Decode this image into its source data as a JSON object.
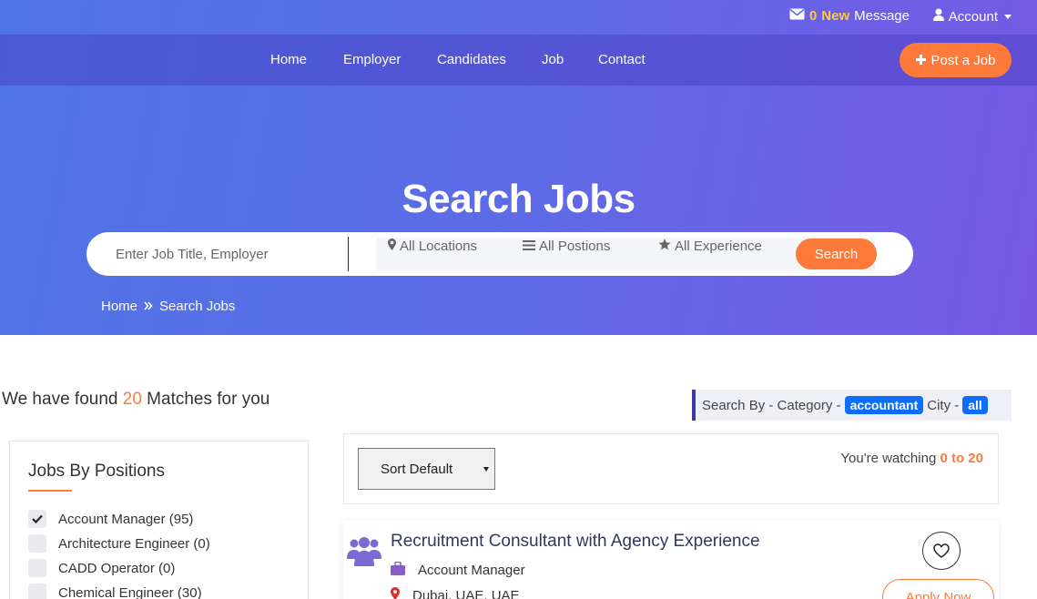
{
  "topbar": {
    "message_count": "0",
    "message_new": "New",
    "message_label": "Message",
    "account_label": "Account"
  },
  "nav": {
    "items": [
      "Home",
      "Employer",
      "Candidates",
      "Job",
      "Contact"
    ],
    "post_job_label": "Post a Job"
  },
  "hero": {
    "title": "Search Jobs",
    "search_placeholder": "Enter Job Title, Employer",
    "location_filter": "All Locations",
    "position_filter": "All Postions",
    "experience_filter": "All Experience",
    "search_button": "Search"
  },
  "breadcrumb": {
    "home": "Home",
    "current": "Search Jobs"
  },
  "results": {
    "found_prefix": "We have found",
    "found_count": "20",
    "found_suffix": "Matches for you",
    "search_by_prefix": "Search By - Category -",
    "category_value": "accountant",
    "city_label": "City -",
    "city_value": "all",
    "sort_selected": "Sort Default",
    "watching_prefix": "You're watching",
    "watching_range": "0 to 20"
  },
  "sidebar": {
    "title": "Jobs By Positions",
    "positions": [
      {
        "label": "Account Manager (95)",
        "checked": true
      },
      {
        "label": "Architecture Engineer (0)",
        "checked": false
      },
      {
        "label": "CADD Operator (0)",
        "checked": false
      },
      {
        "label": "Chemical Engineer (30)",
        "checked": false
      }
    ]
  },
  "job": {
    "title": "Recruitment Consultant with Agency Experience",
    "position": "Account Manager",
    "location": "Dubai, UAE, UAE",
    "apply_label": "Apply Now"
  },
  "colors": {
    "accent": "#fd7a3a",
    "hero_start": "#4f74e6",
    "hero_end": "#775ae3",
    "highlight": "#ffc83d",
    "pill": "#0d6efd"
  },
  "icons": [
    "envelope-icon",
    "user-icon",
    "plus-icon",
    "map-marker-icon",
    "list-icon",
    "star-icon",
    "double-chevron-icon",
    "check-icon",
    "users-icon",
    "briefcase-icon",
    "location-pin-icon",
    "heart-icon"
  ]
}
